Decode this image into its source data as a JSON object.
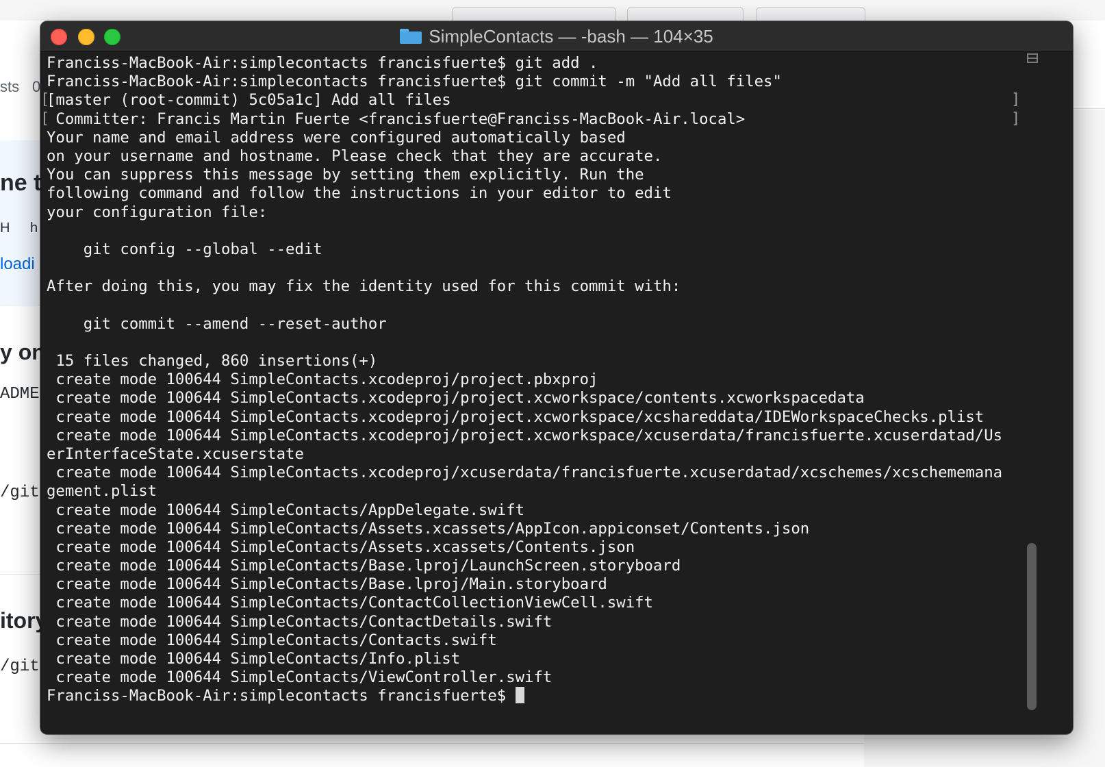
{
  "background": {
    "fragments": [
      "sts",
      "0",
      "ne tl",
      "H",
      "h",
      "loadi",
      "y on",
      "ADME",
      "/git",
      "itory",
      "/git"
    ]
  },
  "window": {
    "title": "SimpleContacts — -bash — 104×35",
    "colors": {
      "close": "#fe5f57",
      "minimize": "#febc2e",
      "zoom": "#28c840",
      "background": "#1e1e1e"
    }
  },
  "terminal": {
    "lines": [
      "Franciss-MacBook-Air:simplecontacts francisfuerte$ git add .",
      "Franciss-MacBook-Air:simplecontacts francisfuerte$ git commit -m \"Add all files\"",
      "[master (root-commit) 5c05a1c] Add all files",
      " Committer: Francis Martin Fuerte <francisfuerte@Franciss-MacBook-Air.local>",
      "Your name and email address were configured automatically based",
      "on your username and hostname. Please check that they are accurate.",
      "You can suppress this message by setting them explicitly. Run the",
      "following command and follow the instructions in your editor to edit",
      "your configuration file:",
      "",
      "    git config --global --edit",
      "",
      "After doing this, you may fix the identity used for this commit with:",
      "",
      "    git commit --amend --reset-author",
      "",
      " 15 files changed, 860 insertions(+)",
      " create mode 100644 SimpleContacts.xcodeproj/project.pbxproj",
      " create mode 100644 SimpleContacts.xcodeproj/project.xcworkspace/contents.xcworkspacedata",
      " create mode 100644 SimpleContacts.xcodeproj/project.xcworkspace/xcshareddata/IDEWorkspaceChecks.plist",
      " create mode 100644 SimpleContacts.xcodeproj/project.xcworkspace/xcuserdata/francisfuerte.xcuserdatad/Us",
      "erInterfaceState.xcuserstate",
      " create mode 100644 SimpleContacts.xcodeproj/xcuserdata/francisfuerte.xcuserdatad/xcschemes/xcschememana",
      "gement.plist",
      " create mode 100644 SimpleContacts/AppDelegate.swift",
      " create mode 100644 SimpleContacts/Assets.xcassets/AppIcon.appiconset/Contents.json",
      " create mode 100644 SimpleContacts/Assets.xcassets/Contents.json",
      " create mode 100644 SimpleContacts/Base.lproj/LaunchScreen.storyboard",
      " create mode 100644 SimpleContacts/Base.lproj/Main.storyboard",
      " create mode 100644 SimpleContacts/ContactCollectionViewCell.swift",
      " create mode 100644 SimpleContacts/ContactDetails.swift",
      " create mode 100644 SimpleContacts/Contacts.swift",
      " create mode 100644 SimpleContacts/Info.plist",
      " create mode 100644 SimpleContacts/ViewController.swift"
    ],
    "prompt": "Franciss-MacBook-Air:simplecontacts francisfuerte$ "
  }
}
